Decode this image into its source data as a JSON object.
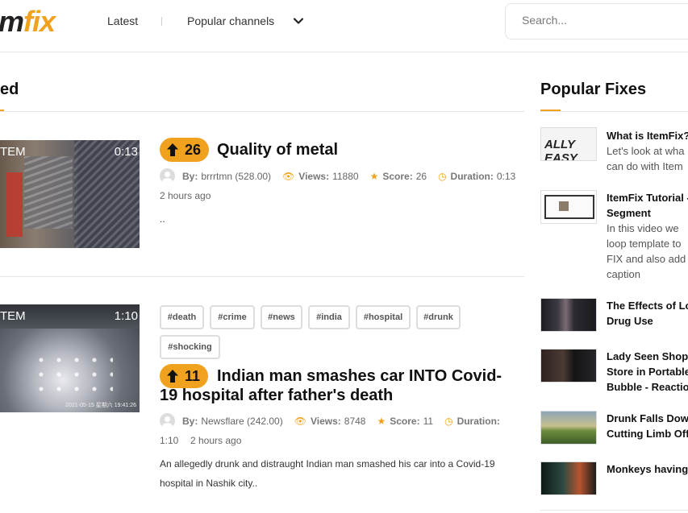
{
  "header": {
    "logo_text": "ItemFix",
    "logo_visible_main": "m",
    "logo_visible_accent": "fix",
    "nav_latest": "Latest",
    "nav_popular": "Popular channels",
    "search_placeholder": "Search..."
  },
  "main": {
    "section_title": "ed",
    "items": [
      {
        "thumb_brand": "TEM",
        "duration_badge": "0:13",
        "votes": "26",
        "title": "Quality of metal",
        "by_label": "By:",
        "author": "brrrtmn (528.00)",
        "views_label": "Views:",
        "views": "11880",
        "score_label": "Score:",
        "score": "26",
        "duration_label": "Duration:",
        "duration": "0:13",
        "ago": "2 hours ago",
        "description": ".."
      },
      {
        "thumb_brand": "TEM",
        "duration_badge": "1:10",
        "thumb_stamp": "2021-05-15  星期六  19:41:26",
        "tags": [
          "#death",
          "#crime",
          "#news",
          "#india",
          "#hospital",
          "#drunk",
          "#shocking"
        ],
        "votes": "11",
        "title_line1": "Indian man smashes car INTO Covid-",
        "title_line2": "19 hospital after father's death",
        "by_label": "By:",
        "author": "Newsflare (242.00)",
        "views_label": "Views:",
        "views": "8748",
        "score_label": "Score:",
        "score": "11",
        "duration_label": "Duration:",
        "duration": "1:10",
        "ago": "2 hours ago",
        "description_line1": "An allegedly drunk and distraught Indian man smashed his car into a Covid-19",
        "description_line2": "hospital in Nashik city.."
      }
    ]
  },
  "sidebar": {
    "title": "Popular Fixes",
    "items": [
      {
        "thumb_text": "ALLY EASY",
        "lines": [
          "What is ItemFix?"
        ],
        "desc": [
          "Let's look at wha",
          "can do with Item"
        ]
      },
      {
        "lines": [
          "ItemFix Tutorial -",
          "Segment"
        ],
        "desc": [
          "In this video we",
          "loop template to",
          "FIX and also add",
          "caption"
        ]
      },
      {
        "lines": [
          "The Effects of Lo",
          "Drug Use"
        ],
        "desc": []
      },
      {
        "lines": [
          "Lady Seen Shop",
          "Store in Portable",
          "Bubble - Reactio"
        ],
        "desc": []
      },
      {
        "lines": [
          "Drunk Falls Dow",
          "Cutting Limb Off"
        ],
        "desc": []
      },
      {
        "lines": [
          "Monkeys having"
        ],
        "desc": []
      }
    ]
  },
  "colors": {
    "accent": "#f0a11e",
    "text": "#111111",
    "muted": "#666666"
  }
}
